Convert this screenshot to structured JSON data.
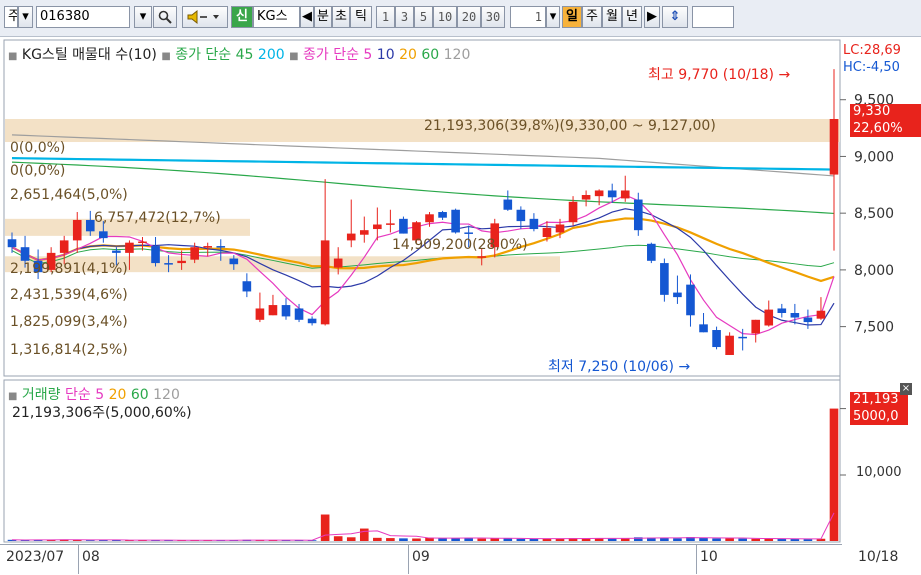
{
  "toolbar": {
    "market": "주",
    "code": "016380",
    "new_badge": "신",
    "name": "KG스",
    "chart_modes": [
      "분",
      "초",
      "틱"
    ],
    "intervals": [
      "1",
      "3",
      "5",
      "10",
      "20",
      "30"
    ],
    "interval_value": "1",
    "periods": [
      "일",
      "주",
      "월",
      "년"
    ],
    "selected_period": "일"
  },
  "price_panel": {
    "legend": {
      "volume_profile": "KG스틸 매물대 수(10)",
      "ma_close": "종가 단순 45",
      "ma_close_200": "200",
      "ma_simple": "종가 단순 5",
      "ma_10": "10",
      "ma_20": "20",
      "ma_60": "60",
      "ma_120": "120"
    },
    "lc": "LC:28,69",
    "hc": "HC:-4,50",
    "high_note": "최고 9,770 (10/18)",
    "low_note": "최저 7,250 (10/06)",
    "price_badge": "9,330",
    "pct_badge": "22,60%",
    "y_ticks": [
      "9,500",
      "9,000",
      "8,500",
      "8,000",
      "7,500"
    ],
    "profile_labels": [
      "21,193,306(39,8%)(9,330,00 ~ 9,127,00)",
      "0(0,0%)",
      "0(0,0%)",
      "2,651,464(5,0%)",
      "6,757,472(12,7%)",
      "14,909,200(28,0%)",
      "2,199,891(4,1%)",
      "2,431,539(4,6%)",
      "1,825,099(3,4%)",
      "1,316,814(2,5%)"
    ]
  },
  "volume_panel": {
    "legend": {
      "title": "거래량",
      "ma": "단순 5",
      "ma_20": "20",
      "ma_60": "60",
      "ma_120": "120"
    },
    "summary": "21,193,306주(5,000,60%)",
    "badge": "21,193",
    "y_ticks": [
      "5000,0",
      "10,000"
    ]
  },
  "x_axis": {
    "labels": [
      "2023/07",
      "08",
      "09",
      "10"
    ],
    "last_date": "10/18"
  },
  "colors": {
    "up": "#e8231c",
    "down": "#1457d2",
    "ma5": "#e63ac0",
    "ma10": "#2c3aa8",
    "ma20": "#f0a000",
    "ma60": "#2aa84a",
    "ma120": "#9e9e9e",
    "ma200": "#00b4e6",
    "profile": "#f3e1c6"
  },
  "chart_data": {
    "type": "candlestick",
    "price_range": [
      7100,
      9850
    ],
    "candles": [
      {
        "o": 8270,
        "h": 8330,
        "l": 8150,
        "c": 8200
      },
      {
        "o": 8200,
        "h": 8300,
        "l": 8020,
        "c": 8080
      },
      {
        "o": 8080,
        "h": 8180,
        "l": 7920,
        "c": 7980
      },
      {
        "o": 8000,
        "h": 8200,
        "l": 7980,
        "c": 8150
      },
      {
        "o": 8150,
        "h": 8300,
        "l": 8050,
        "c": 8260
      },
      {
        "o": 8260,
        "h": 8510,
        "l": 8150,
        "c": 8440
      },
      {
        "o": 8440,
        "h": 8520,
        "l": 8300,
        "c": 8340
      },
      {
        "o": 8340,
        "h": 8430,
        "l": 8240,
        "c": 8280
      },
      {
        "o": 8170,
        "h": 8200,
        "l": 8040,
        "c": 8150
      },
      {
        "o": 8150,
        "h": 8260,
        "l": 8000,
        "c": 8240
      },
      {
        "o": 8240,
        "h": 8290,
        "l": 8170,
        "c": 8250
      },
      {
        "o": 8210,
        "h": 8290,
        "l": 8030,
        "c": 8060
      },
      {
        "o": 8060,
        "h": 8130,
        "l": 7980,
        "c": 8050
      },
      {
        "o": 8060,
        "h": 8170,
        "l": 8000,
        "c": 8080
      },
      {
        "o": 8090,
        "h": 8240,
        "l": 8060,
        "c": 8200
      },
      {
        "o": 8200,
        "h": 8240,
        "l": 8120,
        "c": 8210
      },
      {
        "o": 8210,
        "h": 8270,
        "l": 8080,
        "c": 8200
      },
      {
        "o": 8100,
        "h": 8130,
        "l": 8000,
        "c": 8050
      },
      {
        "o": 7900,
        "h": 7970,
        "l": 7760,
        "c": 7810
      },
      {
        "o": 7560,
        "h": 7800,
        "l": 7540,
        "c": 7660
      },
      {
        "o": 7600,
        "h": 7780,
        "l": 7600,
        "c": 7690
      },
      {
        "o": 7690,
        "h": 7750,
        "l": 7560,
        "c": 7590
      },
      {
        "o": 7660,
        "h": 7700,
        "l": 7540,
        "c": 7560
      },
      {
        "o": 7570,
        "h": 7590,
        "l": 7510,
        "c": 7530
      },
      {
        "o": 7520,
        "h": 8800,
        "l": 7510,
        "c": 8260
      },
      {
        "o": 8020,
        "h": 8200,
        "l": 7960,
        "c": 8100
      },
      {
        "o": 8260,
        "h": 8620,
        "l": 8200,
        "c": 8320
      },
      {
        "o": 8310,
        "h": 8470,
        "l": 8240,
        "c": 8350
      },
      {
        "o": 8360,
        "h": 8550,
        "l": 8260,
        "c": 8400
      },
      {
        "o": 8400,
        "h": 8530,
        "l": 8330,
        "c": 8410
      },
      {
        "o": 8450,
        "h": 8470,
        "l": 8320,
        "c": 8320
      },
      {
        "o": 8260,
        "h": 8430,
        "l": 8240,
        "c": 8420
      },
      {
        "o": 8420,
        "h": 8510,
        "l": 8380,
        "c": 8490
      },
      {
        "o": 8510,
        "h": 8520,
        "l": 8440,
        "c": 8460
      },
      {
        "o": 8530,
        "h": 8540,
        "l": 8320,
        "c": 8330
      },
      {
        "o": 8330,
        "h": 8390,
        "l": 8200,
        "c": 8320
      },
      {
        "o": 8120,
        "h": 8190,
        "l": 8040,
        "c": 8120
      },
      {
        "o": 8200,
        "h": 8450,
        "l": 8110,
        "c": 8410
      },
      {
        "o": 8620,
        "h": 8700,
        "l": 8520,
        "c": 8530
      },
      {
        "o": 8530,
        "h": 8560,
        "l": 8360,
        "c": 8430
      },
      {
        "o": 8450,
        "h": 8500,
        "l": 8340,
        "c": 8360
      },
      {
        "o": 8290,
        "h": 8430,
        "l": 8250,
        "c": 8370
      },
      {
        "o": 8330,
        "h": 8450,
        "l": 8280,
        "c": 8400
      },
      {
        "o": 8420,
        "h": 8650,
        "l": 8390,
        "c": 8600
      },
      {
        "o": 8620,
        "h": 8700,
        "l": 8560,
        "c": 8660
      },
      {
        "o": 8650,
        "h": 8710,
        "l": 8570,
        "c": 8700
      },
      {
        "o": 8700,
        "h": 8760,
        "l": 8590,
        "c": 8640
      },
      {
        "o": 8630,
        "h": 8830,
        "l": 8600,
        "c": 8700
      },
      {
        "o": 8620,
        "h": 8680,
        "l": 8300,
        "c": 8350
      },
      {
        "o": 8230,
        "h": 8240,
        "l": 8060,
        "c": 8080
      },
      {
        "o": 8060,
        "h": 8100,
        "l": 7720,
        "c": 7780
      },
      {
        "o": 7800,
        "h": 7950,
        "l": 7700,
        "c": 7760
      },
      {
        "o": 7870,
        "h": 7960,
        "l": 7500,
        "c": 7600
      },
      {
        "o": 7520,
        "h": 7620,
        "l": 7450,
        "c": 7450
      },
      {
        "o": 7470,
        "h": 7500,
        "l": 7300,
        "c": 7320
      },
      {
        "o": 7250,
        "h": 7450,
        "l": 7250,
        "c": 7420
      },
      {
        "o": 7410,
        "h": 7480,
        "l": 7290,
        "c": 7400
      },
      {
        "o": 7440,
        "h": 7560,
        "l": 7360,
        "c": 7560
      },
      {
        "o": 7510,
        "h": 7730,
        "l": 7500,
        "c": 7650
      },
      {
        "o": 7660,
        "h": 7700,
        "l": 7580,
        "c": 7620
      },
      {
        "o": 7620,
        "h": 7700,
        "l": 7520,
        "c": 7580
      },
      {
        "o": 7580,
        "h": 7650,
        "l": 7480,
        "c": 7540
      },
      {
        "o": 7570,
        "h": 7760,
        "l": 7560,
        "c": 7640
      },
      {
        "o": 8840,
        "h": 9770,
        "l": 8170,
        "c": 9330
      }
    ],
    "volume": [
      45,
      30,
      55,
      38,
      60,
      42,
      28,
      35,
      40,
      30,
      26,
      33,
      30,
      31,
      29,
      27,
      30,
      25,
      45,
      40,
      30,
      26,
      24,
      28,
      1000,
      180,
      140,
      470,
      120,
      110,
      100,
      95,
      130,
      110,
      105,
      120,
      90,
      95,
      100,
      85,
      80,
      95,
      90,
      110,
      100,
      95,
      90,
      105,
      140,
      130,
      120,
      100,
      150,
      120,
      95,
      105,
      90,
      85,
      95,
      80,
      75,
      70,
      85,
      5000
    ],
    "volume_max": 5400
  }
}
